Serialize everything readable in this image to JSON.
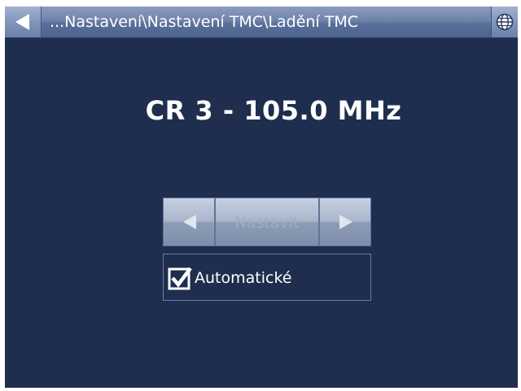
{
  "header": {
    "breadcrumb": "...Nastavení\\Nastavení TMC\\Ladění TMC",
    "back_icon": "back-arrow-icon",
    "globe_icon": "globe-icon"
  },
  "main": {
    "station": "CR 3 - 105.0 MHz",
    "tune": {
      "label": "Nastavit",
      "prev_icon": "left-arrow-icon",
      "next_icon": "right-arrow-icon",
      "enabled": false
    },
    "auto": {
      "label": "Automatické",
      "checked": true
    }
  },
  "colors": {
    "background": "#1f2e4e",
    "titlebar": "#6f84ab",
    "text": "#ffffff",
    "disabled_text": "#a1adc2"
  }
}
